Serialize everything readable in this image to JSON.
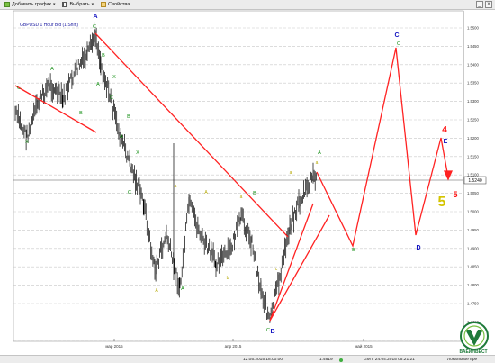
{
  "toolbar": {
    "add_chart_label": "Добавить график",
    "select_label": "Выбрать",
    "properties_label": "Свойства",
    "minimize_label": "_",
    "close_label": "×"
  },
  "chart": {
    "title": "GBPUSD 1 Hour Bid (1 Shift)",
    "current_price": "1.5240",
    "price_ticks": [
      "1.5500",
      "1.5450",
      "1.5400",
      "1.5350",
      "1.5300",
      "1.5250",
      "1.5200",
      "1.5150",
      "1.5100",
      "1.5050",
      "1.5000",
      "1.4950",
      "1.4900",
      "1.4850",
      "1.4800",
      "1.4750",
      "1.4700",
      "1.4650"
    ],
    "time_ticks": [
      "мар 2015",
      "апр 2015",
      "май 2015"
    ],
    "wave_labels": {
      "major": [
        "A",
        "B",
        "C",
        "D",
        "E"
      ],
      "minor": [
        "A",
        "B",
        "C",
        "X",
        "a",
        "b",
        "c"
      ],
      "numbers": [
        "4",
        "5",
        "5"
      ]
    },
    "colors": {
      "bullish_wave": "#ff2222",
      "label_green": "#0a8a0a",
      "label_blue": "#1010c0",
      "label_red": "#ff1010",
      "label_yellow": "#d4c400",
      "minor_yellow": "#b5a800"
    }
  },
  "status": {
    "date": "12.05.2015 18:00:00",
    "scale": "1:4619",
    "gmt": "GMT: 24.04.2015 05:21:21",
    "local": "Локальное вре"
  },
  "logo": {
    "text": "ВАЕИНВЕСТ"
  }
}
